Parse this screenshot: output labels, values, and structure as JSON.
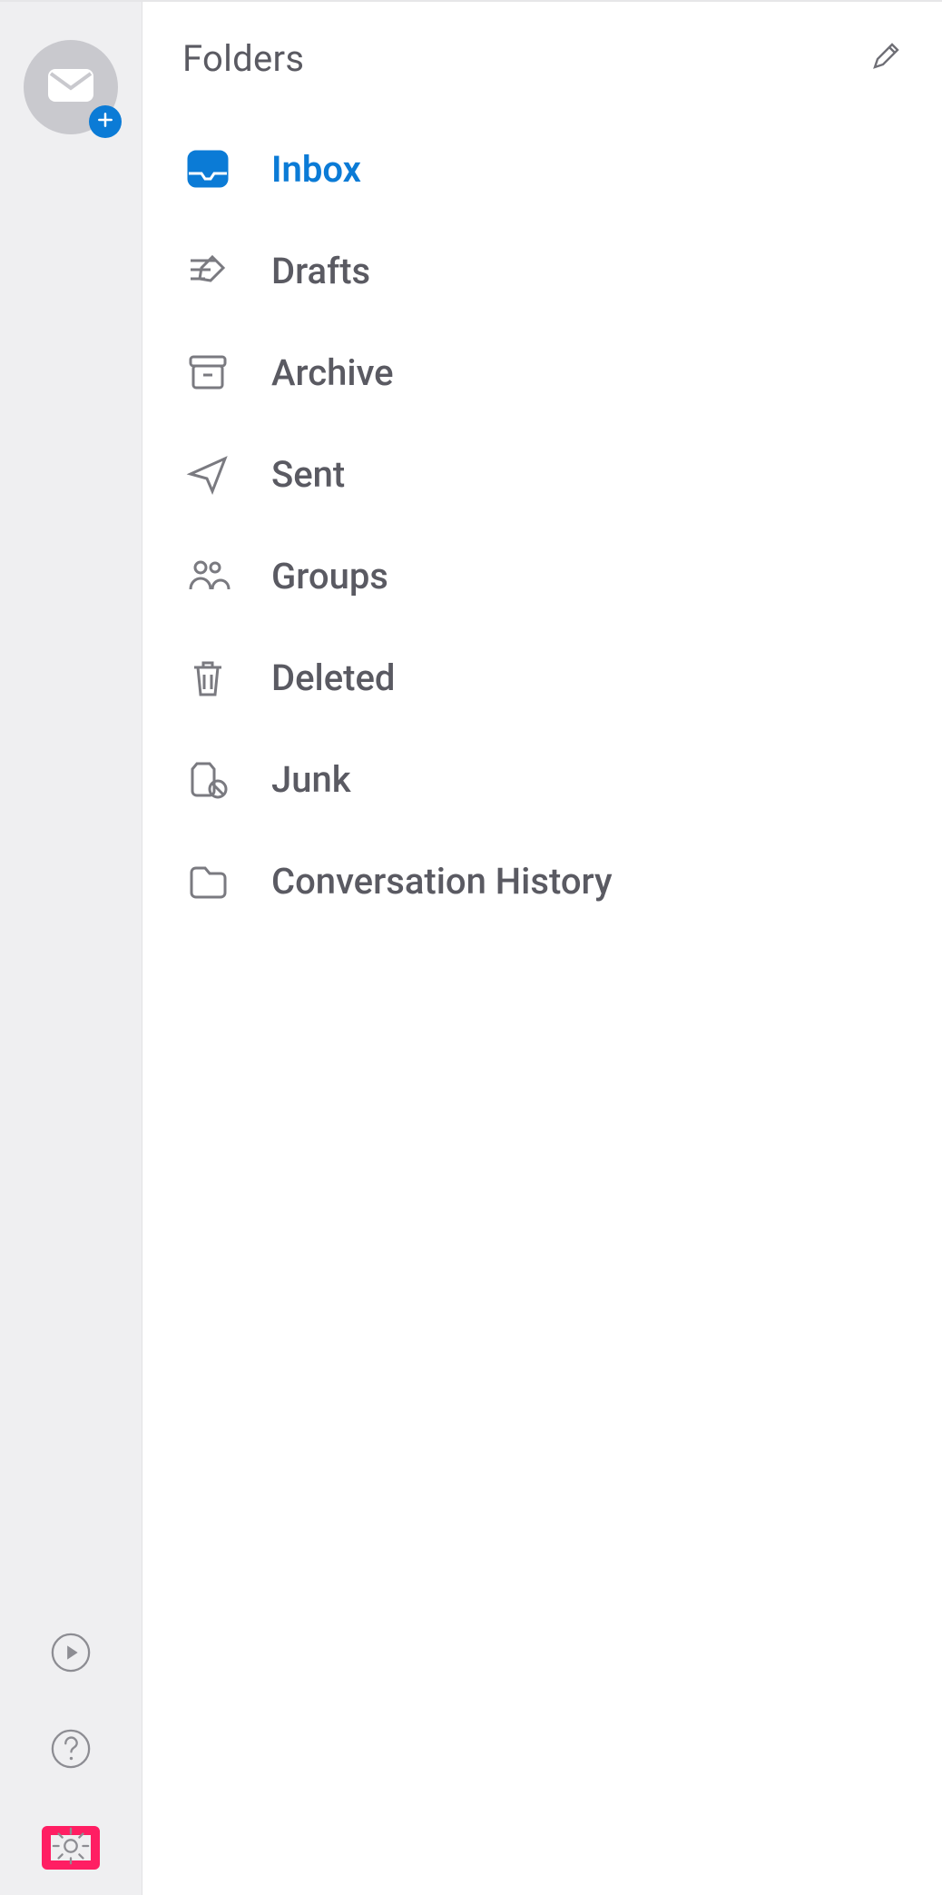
{
  "panel": {
    "title": "Folders"
  },
  "rail": {
    "avatar_icon": "mail-icon",
    "add_account_icon": "plus-icon",
    "tour_icon": "play-circle-icon",
    "help_icon": "question-circle-icon",
    "settings_icon": "gear-icon"
  },
  "edit_icon": "pencil-icon",
  "folders": [
    {
      "id": "inbox",
      "label": "Inbox",
      "icon": "inbox-icon",
      "active": true
    },
    {
      "id": "drafts",
      "label": "Drafts",
      "icon": "draft-icon",
      "active": false
    },
    {
      "id": "archive",
      "label": "Archive",
      "icon": "archive-icon",
      "active": false
    },
    {
      "id": "sent",
      "label": "Sent",
      "icon": "send-icon",
      "active": false
    },
    {
      "id": "groups",
      "label": "Groups",
      "icon": "groups-icon",
      "active": false
    },
    {
      "id": "deleted",
      "label": "Deleted",
      "icon": "trash-icon",
      "active": false
    },
    {
      "id": "junk",
      "label": "Junk",
      "icon": "junk-icon",
      "active": false
    },
    {
      "id": "convhist",
      "label": "Conversation History",
      "icon": "folder-icon",
      "active": false
    }
  ],
  "colors": {
    "accent": "#0b7bd6",
    "highlight_border": "#ff1e63",
    "text_muted": "#5a5a62",
    "icon_muted": "#7a7a80",
    "rail_bg": "#efeff1"
  }
}
